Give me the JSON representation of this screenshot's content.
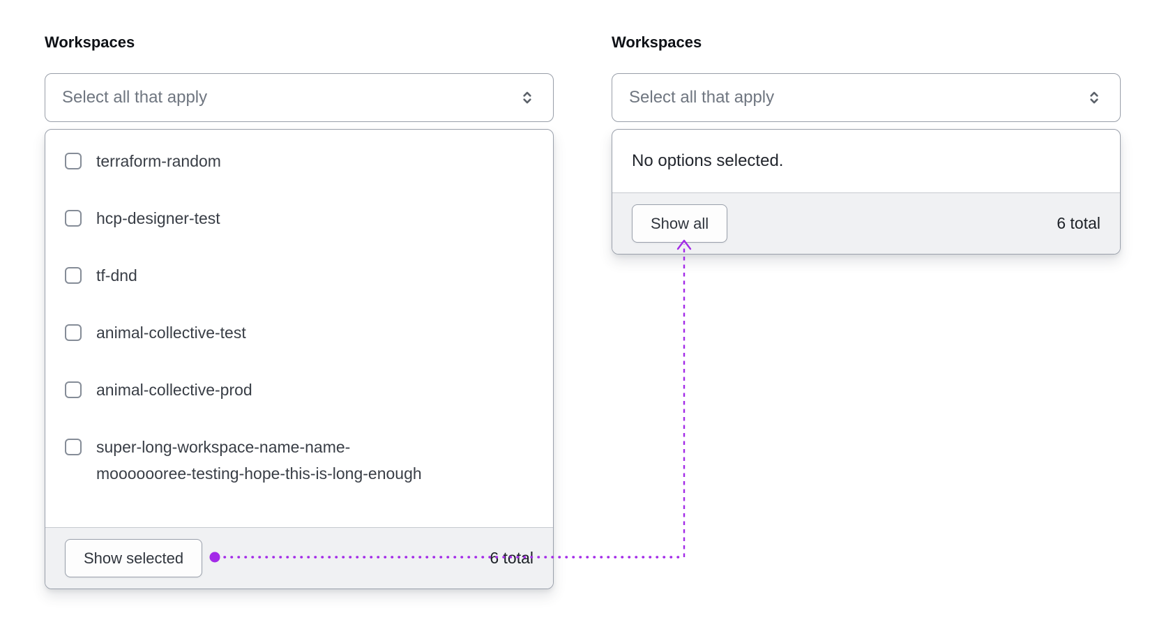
{
  "annotation": {
    "color": "#a32ae8",
    "description": "dotted connector from Show selected button to Show all button"
  },
  "left_component": {
    "label": "Workspaces",
    "toggle_placeholder": "Select all that apply",
    "selector_icon": "chevrons-up-down",
    "options": [
      {
        "label": "terraform-random",
        "checked": false
      },
      {
        "label": "hcp-designer-test",
        "checked": false
      },
      {
        "label": "tf-dnd",
        "checked": false
      },
      {
        "label": "animal-collective-test",
        "checked": false
      },
      {
        "label": "animal-collective-prod",
        "checked": false
      },
      {
        "label": "super-long-workspace-name-name-\nmooooooree-testing-hope-this-is-long-enough",
        "checked": false
      }
    ],
    "footer": {
      "button_label": "Show selected",
      "count_text": "6 total"
    }
  },
  "right_component": {
    "label": "Workspaces",
    "toggle_placeholder": "Select all that apply",
    "selector_icon": "chevrons-up-down",
    "empty_message": "No options selected.",
    "footer": {
      "button_label": "Show all",
      "count_text": "6 total"
    }
  }
}
